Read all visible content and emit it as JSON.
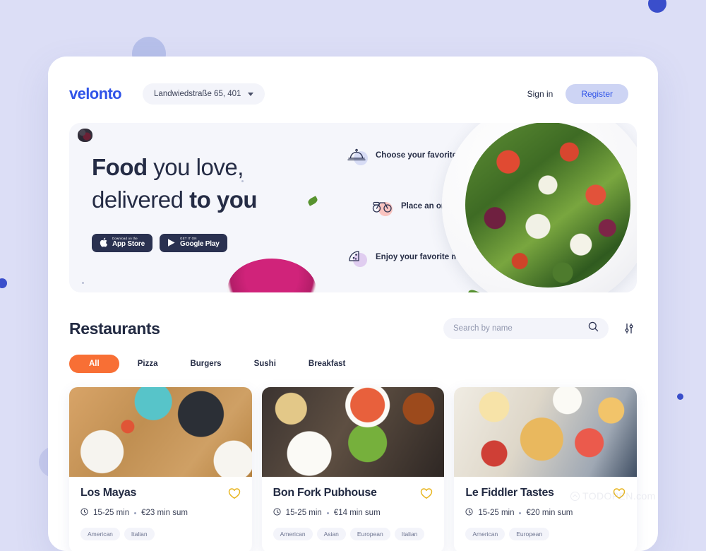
{
  "theme": {
    "page_bg": "#dcdef6",
    "brand_blue": "#2f53e8",
    "accent_orange": "#f86f35",
    "ink": "#222a42",
    "heart_gold": "#e8b621",
    "panel_grey": "#f3f4fa"
  },
  "header": {
    "logo": "velonto",
    "address": "Landwiedstraße 65, 401",
    "caret_icon": "chevron-down-icon",
    "sign_in_label": "Sign in",
    "register_label": "Register"
  },
  "hero": {
    "title_part1": "Food",
    "title_part2": " you love,",
    "title_part3": "delivered ",
    "title_part4": "to you",
    "badges": [
      {
        "icon": "apple-icon",
        "glyph": "",
        "small": "Download on the",
        "big": "App Store"
      },
      {
        "icon": "google-play-icon",
        "glyph": "▶",
        "small": "GET IT ON",
        "big": "Google Play"
      }
    ],
    "steps": [
      {
        "icon": "food-dome-icon",
        "label": "Choose your favorite meal"
      },
      {
        "icon": "delivery-bike-icon",
        "label": "Place an order"
      },
      {
        "icon": "pizza-slice-icon",
        "label": "Enjoy your favorite meal!"
      }
    ]
  },
  "restaurants": {
    "title": "Restaurants",
    "search": {
      "value": "",
      "placeholder": "Search by name",
      "icon": "search-icon"
    },
    "filter_icon": "filter-sliders-icon",
    "tabs": [
      {
        "label": "All",
        "active": true
      },
      {
        "label": "Pizza",
        "active": false
      },
      {
        "label": "Burgers",
        "active": false
      },
      {
        "label": "Sushi",
        "active": false
      },
      {
        "label": "Breakfast",
        "active": false
      }
    ],
    "cards": [
      {
        "name": "Los Mayas",
        "delivery_time": "15-25 min",
        "min_sum": "€23 min sum",
        "clock_icon": "clock-icon",
        "favorite_icon": "heart-icon",
        "tags": [
          "American",
          "Italian"
        ]
      },
      {
        "name": "Bon Fork Pubhouse",
        "delivery_time": "15-25 min",
        "min_sum": "€14 min sum",
        "clock_icon": "clock-icon",
        "favorite_icon": "heart-icon",
        "tags": [
          "American",
          "Asian",
          "European",
          "Italian"
        ]
      },
      {
        "name": "Le Fiddler Tastes",
        "delivery_time": "15-25 min",
        "min_sum": "€20 min sum",
        "clock_icon": "clock-icon",
        "favorite_icon": "heart-icon",
        "tags": [
          "American",
          "European"
        ]
      }
    ]
  },
  "watermark": {
    "text": "TODOPEN.com"
  }
}
